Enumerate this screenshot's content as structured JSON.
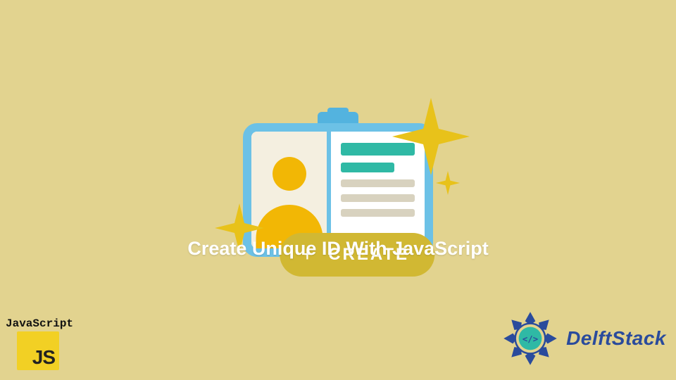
{
  "illustration": {
    "create_button_label": "CREATE",
    "sparkle_color": "#e8c21a",
    "card_frame_color": "#6cc1e6",
    "accent_bar_color": "#2fb9a5",
    "avatar_color": "#f2b705"
  },
  "title": "Create Unique ID With JavaScript",
  "logos": {
    "javascript": {
      "label": "JavaScript",
      "glyph": "JS"
    },
    "delftstack": {
      "label": "DelftStack",
      "code_glyph": "</>"
    }
  },
  "colors": {
    "background": "#e2d38f",
    "pill": "#d1b833",
    "brand_blue": "#2a4b9c"
  }
}
